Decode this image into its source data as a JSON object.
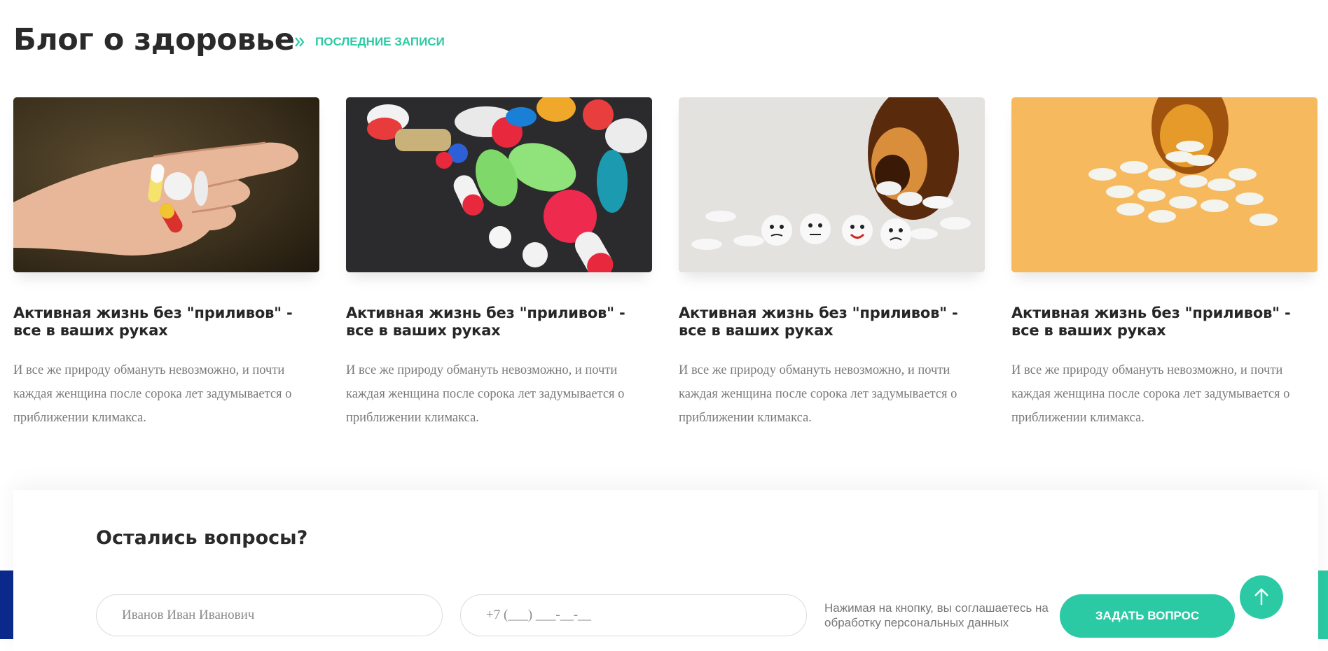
{
  "blog": {
    "title": "Блог о здоровье",
    "latest_link": "ПОСЛЕДНИЕ ЗАПИСИ",
    "accent_color": "#2bcaa5"
  },
  "posts": [
    {
      "title": "Активная жизнь без \"приливов\" - все в ваших руках",
      "excerpt": "И все же природу обмануть невозможно, и почти каждая женщина после сорока лет задумывается о приближении климакса."
    },
    {
      "title": "Активная жизнь без \"приливов\" - все в ваших руках",
      "excerpt": "И все же природу обмануть невозможно, и почти каждая женщина после сорока лет задумывается о приближении климакса."
    },
    {
      "title": "Активная жизнь без \"приливов\" - все в ваших руках",
      "excerpt": "И все же природу обмануть невозможно, и почти каждая женщина после сорока лет задумывается о приближении климакса."
    },
    {
      "title": "Активная жизнь без \"приливов\" - все в ваших руках",
      "excerpt": "И все же природу обмануть невозможно, и почти каждая женщина после сорока лет задумывается о приближении климакса."
    }
  ],
  "questions": {
    "title": "Остались вопросы?",
    "name_placeholder": "Иванов Иван Иванович",
    "phone_placeholder": "+7 (___) ___-__-__",
    "consent_text": "Нажимая на кнопку, вы соглашаетесь на обработку персональных данных",
    "submit_label": "ЗАДАТЬ ВОПРОС"
  }
}
